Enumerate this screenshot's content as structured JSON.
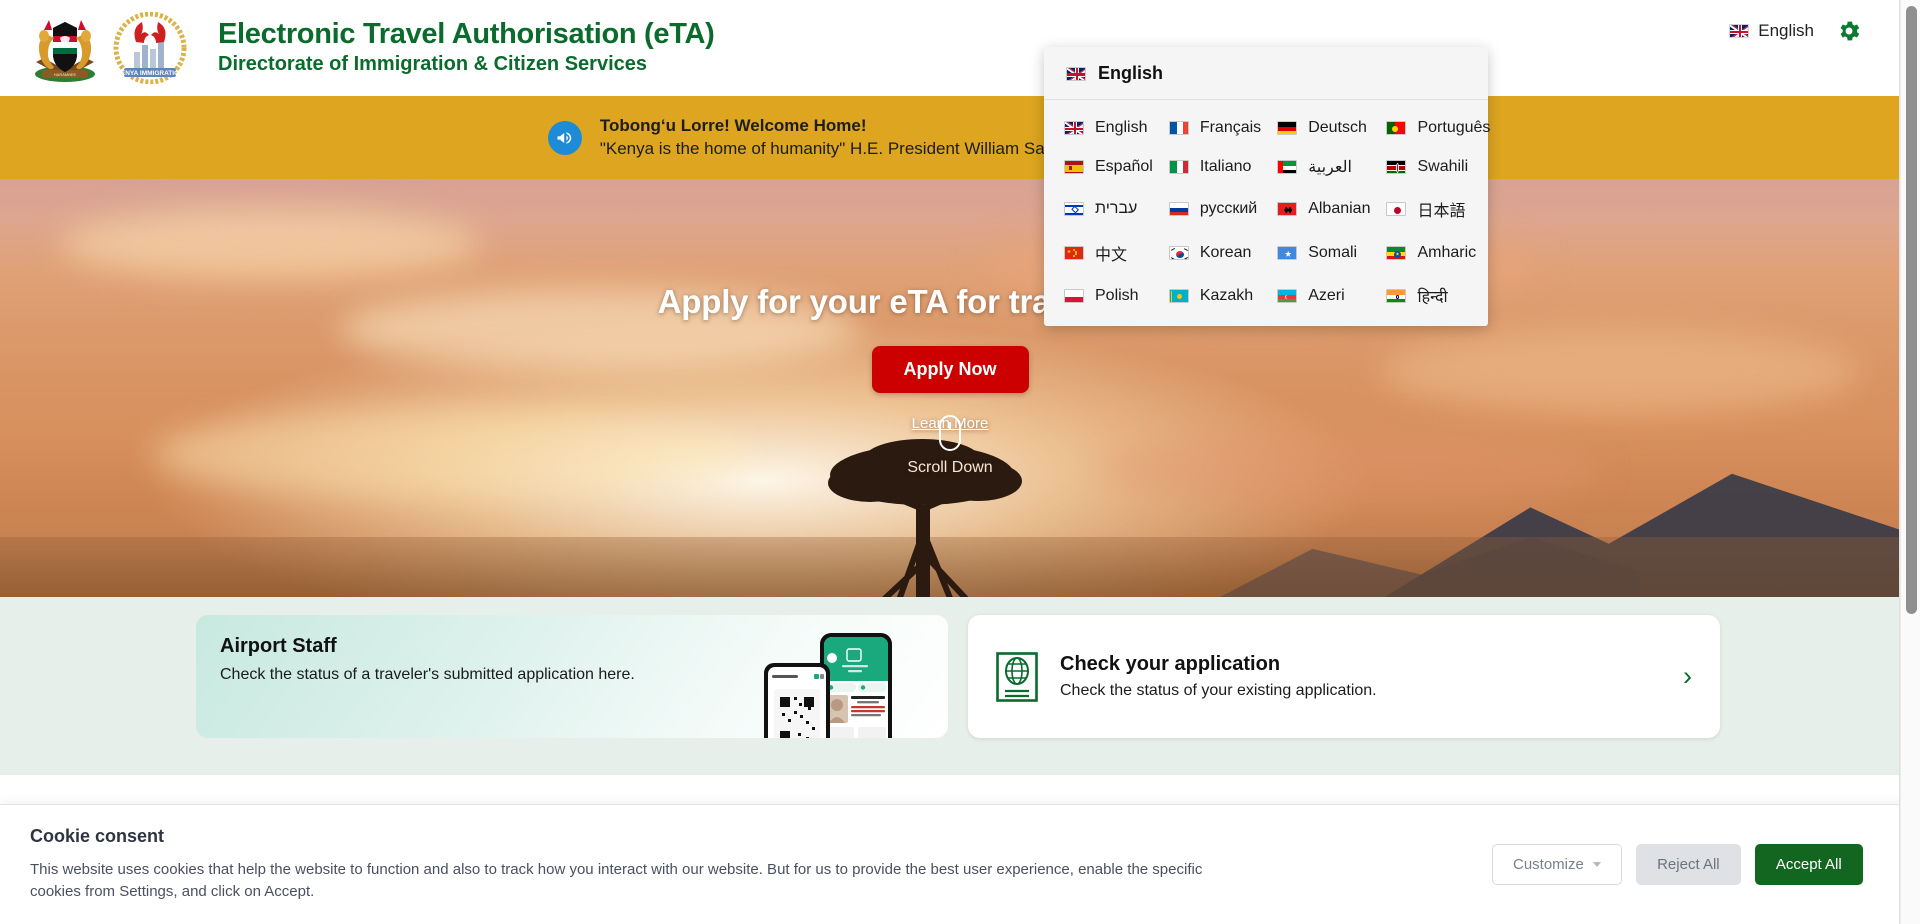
{
  "header": {
    "brand_title": "Electronic Travel Authorisation (eTA)",
    "brand_subtitle": "Directorate of Immigration & Citizen Services",
    "language_label": "English",
    "language_flag": "uk-flag-icon",
    "settings_icon": "gear-icon",
    "logo_left": "kenya-coat-of-arms-logo",
    "logo_right": "kenya-immigration-logo"
  },
  "announcement": {
    "icon": "megaphone-icon",
    "line1": "Tobong‘u Lorre! Welcome Home!",
    "line2": "\"Kenya is the home of humanity\" H.E. President William Samoei Ruto"
  },
  "hero": {
    "headline": "Apply for your eTA for travel to Kenya",
    "apply_label": "Apply Now",
    "learn_more_label": "Learn More",
    "scroll_label": "Scroll Down",
    "scroll_icon": "mouse-scroll-icon"
  },
  "cards": {
    "airport": {
      "title": "Airport Staff",
      "description": "Check the status of a traveler's submitted application here.",
      "image": "phone-mockup-image"
    },
    "check": {
      "icon": "globe-document-icon",
      "title": "Check your application",
      "description": "Check the status of your existing application.",
      "chevron": "chevron-right-icon"
    }
  },
  "language_dropdown": {
    "current_label": "English",
    "current_flag": "uk-flag-icon",
    "items": [
      {
        "label": "English",
        "flag": "uk-flag-icon"
      },
      {
        "label": "Français",
        "flag": "france-flag-icon"
      },
      {
        "label": "Deutsch",
        "flag": "germany-flag-icon"
      },
      {
        "label": "Português",
        "flag": "portugal-flag-icon"
      },
      {
        "label": "Español",
        "flag": "spain-flag-icon"
      },
      {
        "label": "Italiano",
        "flag": "italy-flag-icon"
      },
      {
        "label": "العربية",
        "flag": "uae-flag-icon"
      },
      {
        "label": "Swahili",
        "flag": "kenya-flag-icon"
      },
      {
        "label": "עברית",
        "flag": "israel-flag-icon"
      },
      {
        "label": "русский",
        "flag": "russia-flag-icon"
      },
      {
        "label": "Albanian",
        "flag": "albania-flag-icon"
      },
      {
        "label": "日本語",
        "flag": "japan-flag-icon"
      },
      {
        "label": "中文",
        "flag": "china-flag-icon"
      },
      {
        "label": "Korean",
        "flag": "south-korea-flag-icon"
      },
      {
        "label": "Somali",
        "flag": "somalia-flag-icon"
      },
      {
        "label": "Amharic",
        "flag": "ethiopia-flag-icon"
      },
      {
        "label": "Polish",
        "flag": "poland-flag-icon"
      },
      {
        "label": "Kazakh",
        "flag": "kazakhstan-flag-icon"
      },
      {
        "label": "Azeri",
        "flag": "azerbaijan-flag-icon"
      },
      {
        "label": "हिन्दी",
        "flag": "india-flag-icon"
      }
    ]
  },
  "cookie_consent": {
    "title": "Cookie consent",
    "text": "This website uses cookies that help the website to function and also to track how you interact with our website. But for us to provide the best user experience, enable the specific cookies from Settings, and click on Accept.",
    "customize_label": "Customize",
    "reject_label": "Reject All",
    "accept_label": "Accept All"
  },
  "colors": {
    "brand_green": "#0a6b2d",
    "announcement_bg": "#dda520",
    "apply_red": "#cc0000",
    "accept_green": "#13661f",
    "cards_bg": "#e6efe9"
  }
}
